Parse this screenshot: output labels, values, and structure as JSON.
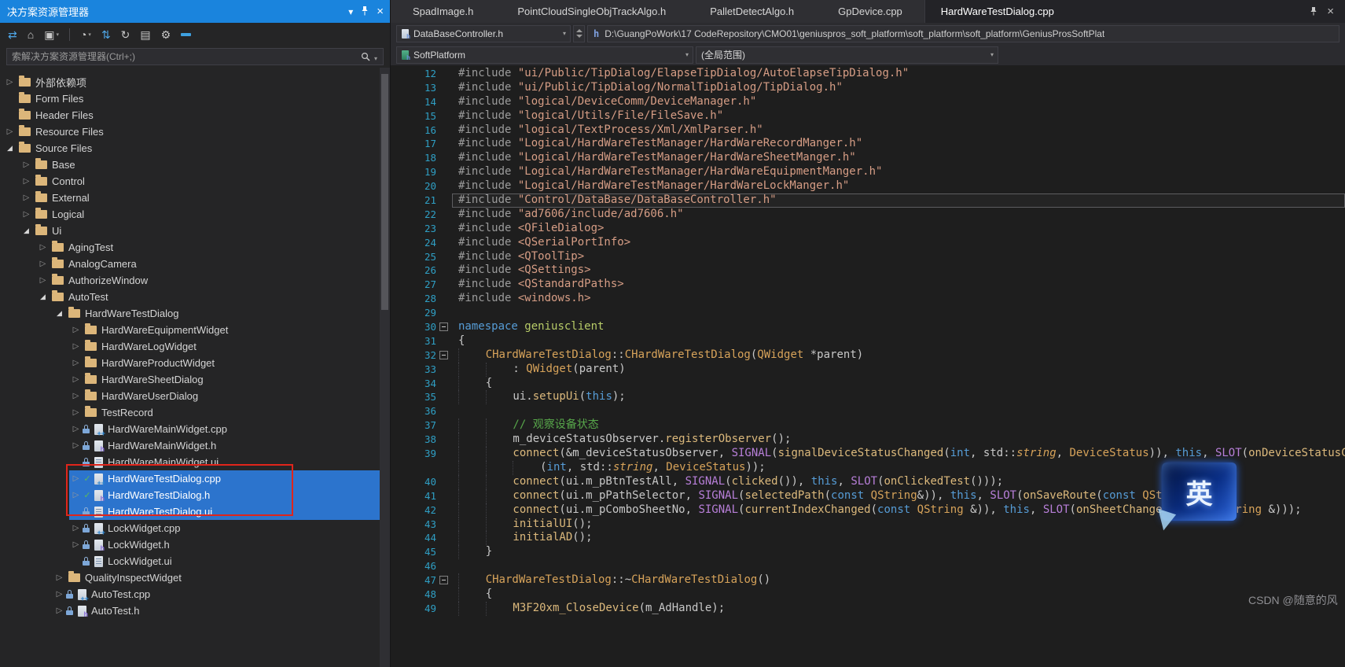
{
  "icons": {
    "chevron_down": "▾",
    "close": "×",
    "search_caret": "▾",
    "tree_collapsed": "▷",
    "tree_expanded": "◢",
    "check": "✓"
  },
  "watermark": "CSDN @随意的风",
  "ime": {
    "label": "英"
  },
  "solution_explorer": {
    "title": "决方案资源管理器",
    "search_placeholder": "索解决方案资源管理器(Ctrl+;)",
    "toolbar": [
      {
        "name": "back-forward-icon",
        "glyph": "⇄",
        "color": "#4fa7e8"
      },
      {
        "name": "home-icon",
        "glyph": "⌂",
        "color": "#c8c8c8"
      },
      {
        "name": "switch-views-icon",
        "glyph": "▣",
        "color": "#c8c8c8",
        "caret": true
      },
      {
        "name": "separator"
      },
      {
        "name": "pending-changes-filter-icon",
        "glyph": "◔",
        "color": "#c8c8c8",
        "caret": true
      },
      {
        "name": "sync-with-active-document-icon",
        "glyph": "⇅",
        "color": "#4fa7e8"
      },
      {
        "name": "refresh-icon",
        "glyph": "↻",
        "color": "#c8c8c8"
      },
      {
        "name": "collapse-all-icon",
        "glyph": "▤",
        "color": "#c8c8c8"
      },
      {
        "name": "properties-wrench-icon",
        "glyph": "⚙",
        "color": "#c8c8c8"
      },
      {
        "name": "blue-dash-icon",
        "glyph": "bar",
        "color": "#3ea0e0"
      }
    ],
    "tree": [
      {
        "label": "外部依赖项",
        "depth": 0,
        "expand": "closed",
        "icon": "folder"
      },
      {
        "label": "Form Files",
        "depth": 0,
        "expand": "none",
        "icon": "folder"
      },
      {
        "label": "Header Files",
        "depth": 0,
        "expand": "none",
        "icon": "folder"
      },
      {
        "label": "Resource Files",
        "depth": 0,
        "expand": "closed",
        "icon": "folder"
      },
      {
        "label": "Source Files",
        "depth": 0,
        "expand": "open",
        "icon": "folder"
      },
      {
        "label": "Base",
        "depth": 1,
        "expand": "closed",
        "icon": "folder"
      },
      {
        "label": "Control",
        "depth": 1,
        "expand": "closed",
        "icon": "folder"
      },
      {
        "label": "External",
        "depth": 1,
        "expand": "closed",
        "icon": "folder"
      },
      {
        "label": "Logical",
        "depth": 1,
        "expand": "closed",
        "icon": "folder"
      },
      {
        "label": "Ui",
        "depth": 1,
        "expand": "open",
        "icon": "folder"
      },
      {
        "label": "AgingTest",
        "depth": 2,
        "expand": "closed",
        "icon": "folder"
      },
      {
        "label": "AnalogCamera",
        "depth": 2,
        "expand": "closed",
        "icon": "folder"
      },
      {
        "label": "AuthorizeWindow",
        "depth": 2,
        "expand": "closed",
        "icon": "folder"
      },
      {
        "label": "AutoTest",
        "depth": 2,
        "expand": "open",
        "icon": "folder"
      },
      {
        "label": "HardWareTestDialog",
        "depth": 3,
        "expand": "open",
        "icon": "folder"
      },
      {
        "label": "HardWareEquipmentWidget",
        "depth": 4,
        "expand": "closed",
        "icon": "folder"
      },
      {
        "label": "HardWareLogWidget",
        "depth": 4,
        "expand": "closed",
        "icon": "folder"
      },
      {
        "label": "HardWareProductWidget",
        "depth": 4,
        "expand": "closed",
        "icon": "folder"
      },
      {
        "label": "HardWareSheetDialog",
        "depth": 4,
        "expand": "closed",
        "icon": "folder"
      },
      {
        "label": "HardWareUserDialog",
        "depth": 4,
        "expand": "closed",
        "icon": "folder"
      },
      {
        "label": "TestRecord",
        "depth": 4,
        "expand": "closed",
        "icon": "folder"
      },
      {
        "label": "HardWareMainWidget.cpp",
        "depth": 4,
        "expand": "closed",
        "icon": "cpp",
        "badge": "lock"
      },
      {
        "label": "HardWareMainWidget.h",
        "depth": 4,
        "expand": "closed",
        "icon": "h",
        "badge": "lock"
      },
      {
        "label": "HardWareMainWidget.ui",
        "depth": 4,
        "expand": "none",
        "icon": "ui",
        "badge": "lock"
      },
      {
        "label": "HardWareTestDialog.cpp",
        "depth": 4,
        "expand": "closed",
        "icon": "cpp",
        "badge": "check",
        "selected": true
      },
      {
        "label": "HardWareTestDialog.h",
        "depth": 4,
        "expand": "closed",
        "icon": "h",
        "badge": "check",
        "selected": true
      },
      {
        "label": "HardWareTestDialog.ui",
        "depth": 4,
        "expand": "none",
        "icon": "ui",
        "badge": "lock",
        "selected": true
      },
      {
        "label": "LockWidget.cpp",
        "depth": 4,
        "expand": "closed",
        "icon": "cpp",
        "badge": "lock"
      },
      {
        "label": "LockWidget.h",
        "depth": 4,
        "expand": "closed",
        "icon": "h",
        "badge": "lock"
      },
      {
        "label": "LockWidget.ui",
        "depth": 4,
        "expand": "none",
        "icon": "ui",
        "badge": "lock"
      },
      {
        "label": "QualityInspectWidget",
        "depth": 3,
        "expand": "closed",
        "icon": "folder"
      },
      {
        "label": "AutoTest.cpp",
        "depth": 3,
        "expand": "closed",
        "icon": "cpp",
        "badge": "lock"
      },
      {
        "label": "AutoTest.h",
        "depth": 3,
        "expand": "closed",
        "icon": "h",
        "badge": "lock"
      }
    ]
  },
  "editor": {
    "tabs": [
      {
        "label": "SpadImage.h"
      },
      {
        "label": "PointCloudSingleObjTrackAlgo.h"
      },
      {
        "label": "PalletDetectAlgo.h"
      },
      {
        "label": "GpDevice.cpp"
      },
      {
        "label": "HardWareTestDialog.cpp",
        "active": true
      }
    ],
    "nav": {
      "dropdown": "DataBaseController.h",
      "path": "D:\\GuangPoWork\\17 CodeRepository\\CMO01\\geniuspros_soft_platform\\soft_platform\\soft_platform\\GeniusProsSoftPlat",
      "project": "SoftPlatform",
      "scope": "(全局范围)"
    },
    "code_lines": [
      {
        "n": "12",
        "s": [
          [
            "pp",
            "#include "
          ],
          [
            "str",
            "\"ui/Public/TipDialog/ElapseTipDialog/AutoElapseTipDialog.h\""
          ]
        ]
      },
      {
        "n": "13",
        "s": [
          [
            "pp",
            "#include "
          ],
          [
            "str",
            "\"ui/Public/TipDialog/NormalTipDialog/TipDialog.h\""
          ]
        ]
      },
      {
        "n": "14",
        "s": [
          [
            "pp",
            "#include "
          ],
          [
            "str",
            "\"logical/DeviceComm/DeviceManager.h\""
          ]
        ]
      },
      {
        "n": "15",
        "s": [
          [
            "pp",
            "#include "
          ],
          [
            "str",
            "\"logical/Utils/File/FileSave.h\""
          ]
        ]
      },
      {
        "n": "16",
        "s": [
          [
            "pp",
            "#include "
          ],
          [
            "str",
            "\"logical/TextProcess/Xml/XmlParser.h\""
          ]
        ]
      },
      {
        "n": "17",
        "s": [
          [
            "pp",
            "#include "
          ],
          [
            "str",
            "\"Logical/HardWareTestManager/HardWareRecordManger.h\""
          ]
        ]
      },
      {
        "n": "18",
        "s": [
          [
            "pp",
            "#include "
          ],
          [
            "str",
            "\"Logical/HardWareTestManager/HardWareSheetManger.h\""
          ]
        ]
      },
      {
        "n": "19",
        "s": [
          [
            "pp",
            "#include "
          ],
          [
            "str",
            "\"Logical/HardWareTestManager/HardWareEquipmentManger.h\""
          ]
        ]
      },
      {
        "n": "20",
        "s": [
          [
            "pp",
            "#include "
          ],
          [
            "str",
            "\"Logical/HardWareTestManager/HardWareLockManger.h\""
          ]
        ]
      },
      {
        "n": "21",
        "cur": true,
        "s": [
          [
            "pp",
            "#include "
          ],
          [
            "str",
            "\"Control/DataBase/DataBaseController.h\""
          ]
        ]
      },
      {
        "n": "22",
        "s": [
          [
            "pp",
            "#include "
          ],
          [
            "str",
            "\"ad7606/include/ad7606.h\""
          ]
        ]
      },
      {
        "n": "23",
        "s": [
          [
            "pp",
            "#include "
          ],
          [
            "str",
            "<QFileDialog>"
          ]
        ]
      },
      {
        "n": "24",
        "s": [
          [
            "pp",
            "#include "
          ],
          [
            "str",
            "<QSerialPortInfo>"
          ]
        ]
      },
      {
        "n": "25",
        "s": [
          [
            "pp",
            "#include "
          ],
          [
            "str",
            "<QToolTip>"
          ]
        ]
      },
      {
        "n": "26",
        "s": [
          [
            "pp",
            "#include "
          ],
          [
            "str",
            "<QSettings>"
          ]
        ]
      },
      {
        "n": "27",
        "s": [
          [
            "pp",
            "#include "
          ],
          [
            "str",
            "<QStandardPaths>"
          ]
        ]
      },
      {
        "n": "28",
        "s": [
          [
            "pp",
            "#include "
          ],
          [
            "str",
            "<windows.h>"
          ]
        ]
      },
      {
        "n": "29",
        "s": []
      },
      {
        "n": "30",
        "fold": true,
        "s": [
          [
            "kw",
            "namespace"
          ],
          [
            "id",
            " "
          ],
          [
            "ns",
            "geniusclient"
          ]
        ]
      },
      {
        "n": "31",
        "s": [
          [
            "id",
            "{"
          ]
        ]
      },
      {
        "n": "32",
        "fold": true,
        "s": [
          [
            "id",
            "    "
          ],
          [
            "type",
            "CHardWareTestDialog"
          ],
          [
            "id",
            "::"
          ],
          [
            "type",
            "CHardWareTestDialog"
          ],
          [
            "id",
            "("
          ],
          [
            "type",
            "QWidget"
          ],
          [
            "id",
            " *parent)"
          ]
        ]
      },
      {
        "n": "33",
        "s": [
          [
            "id",
            "        : "
          ],
          [
            "type",
            "QWidget"
          ],
          [
            "id",
            "(parent)"
          ]
        ]
      },
      {
        "n": "34",
        "s": [
          [
            "id",
            "    {"
          ]
        ]
      },
      {
        "n": "35",
        "s": [
          [
            "id",
            "        ui."
          ],
          [
            "fn",
            "setupUi"
          ],
          [
            "id",
            "("
          ],
          [
            "kw",
            "this"
          ],
          [
            "id",
            ");"
          ]
        ]
      },
      {
        "n": "36",
        "s": []
      },
      {
        "n": "37",
        "s": [
          [
            "id",
            "        "
          ],
          [
            "cmt",
            "// 观察设备状态"
          ]
        ]
      },
      {
        "n": "38",
        "s": [
          [
            "id",
            "        m_deviceStatusObserver."
          ],
          [
            "fn",
            "registerObserver"
          ],
          [
            "id",
            "();"
          ]
        ]
      },
      {
        "n": "39",
        "s": [
          [
            "id",
            "        "
          ],
          [
            "fn",
            "connect"
          ],
          [
            "id",
            "(&m_deviceStatusObserver, "
          ],
          [
            "mac",
            "SIGNAL"
          ],
          [
            "id",
            "("
          ],
          [
            "fn",
            "signalDeviceStatusChanged"
          ],
          [
            "id",
            "("
          ],
          [
            "kw",
            "int"
          ],
          [
            "id",
            ", std::"
          ],
          [
            "typei",
            "string"
          ],
          [
            "id",
            ", "
          ],
          [
            "type",
            "DeviceStatus"
          ],
          [
            "id",
            ")), "
          ],
          [
            "kw",
            "this"
          ],
          [
            "id",
            ", "
          ],
          [
            "mac",
            "SLOT"
          ],
          [
            "id",
            "("
          ],
          [
            "fn",
            "onDeviceStatusChanged"
          ],
          [
            "id",
            "("
          ]
        ]
      },
      {
        "n": "",
        "s": [
          [
            "id",
            "            ("
          ],
          [
            "kw",
            "int"
          ],
          [
            "id",
            ", std::"
          ],
          [
            "typei",
            "string"
          ],
          [
            "id",
            ", "
          ],
          [
            "type",
            "DeviceStatus"
          ],
          [
            "id",
            "));"
          ]
        ]
      },
      {
        "n": "40",
        "s": [
          [
            "id",
            "        "
          ],
          [
            "fn",
            "connect"
          ],
          [
            "id",
            "(ui.m_pBtnTestAll, "
          ],
          [
            "mac",
            "SIGNAL"
          ],
          [
            "id",
            "("
          ],
          [
            "fn",
            "clicked"
          ],
          [
            "id",
            "()), "
          ],
          [
            "kw",
            "this"
          ],
          [
            "id",
            ", "
          ],
          [
            "mac",
            "SLOT"
          ],
          [
            "id",
            "("
          ],
          [
            "fn",
            "onClickedTest"
          ],
          [
            "id",
            "()));"
          ]
        ]
      },
      {
        "n": "41",
        "s": [
          [
            "id",
            "        "
          ],
          [
            "fn",
            "connect"
          ],
          [
            "id",
            "(ui.m_pPathSelector, "
          ],
          [
            "mac",
            "SIGNAL"
          ],
          [
            "id",
            "("
          ],
          [
            "fn",
            "selectedPath"
          ],
          [
            "id",
            "("
          ],
          [
            "kw",
            "const"
          ],
          [
            "id",
            " "
          ],
          [
            "type",
            "QString"
          ],
          [
            "id",
            "&)), "
          ],
          [
            "kw",
            "this"
          ],
          [
            "id",
            ", "
          ],
          [
            "mac",
            "SLOT"
          ],
          [
            "id",
            "("
          ],
          [
            "fn",
            "onSaveRoute"
          ],
          [
            "id",
            "("
          ],
          [
            "kw",
            "const"
          ],
          [
            "id",
            " "
          ],
          [
            "type",
            "QString"
          ],
          [
            "id",
            "&)));"
          ]
        ]
      },
      {
        "n": "42",
        "s": [
          [
            "id",
            "        "
          ],
          [
            "fn",
            "connect"
          ],
          [
            "id",
            "(ui.m_pComboSheetNo, "
          ],
          [
            "mac",
            "SIGNAL"
          ],
          [
            "id",
            "("
          ],
          [
            "fn",
            "currentIndexChanged"
          ],
          [
            "id",
            "("
          ],
          [
            "kw",
            "const"
          ],
          [
            "id",
            " "
          ],
          [
            "type",
            "QString"
          ],
          [
            "id",
            " &)), "
          ],
          [
            "kw",
            "this"
          ],
          [
            "id",
            ", "
          ],
          [
            "mac",
            "SLOT"
          ],
          [
            "id",
            "("
          ],
          [
            "fn",
            "onSheetChanged"
          ],
          [
            "id",
            "("
          ],
          [
            "kw",
            "const"
          ],
          [
            "id",
            " "
          ],
          [
            "type",
            "QString"
          ],
          [
            "id",
            " &)));"
          ]
        ]
      },
      {
        "n": "43",
        "s": [
          [
            "id",
            "        "
          ],
          [
            "fn",
            "initialUI"
          ],
          [
            "id",
            "();"
          ]
        ]
      },
      {
        "n": "44",
        "s": [
          [
            "id",
            "        "
          ],
          [
            "fn",
            "initialAD"
          ],
          [
            "id",
            "();"
          ]
        ]
      },
      {
        "n": "45",
        "s": [
          [
            "id",
            "    }"
          ]
        ]
      },
      {
        "n": "46",
        "s": []
      },
      {
        "n": "47",
        "fold": true,
        "s": [
          [
            "id",
            "    "
          ],
          [
            "type",
            "CHardWareTestDialog"
          ],
          [
            "id",
            "::~"
          ],
          [
            "type",
            "CHardWareTestDialog"
          ],
          [
            "id",
            "()"
          ]
        ]
      },
      {
        "n": "48",
        "s": [
          [
            "id",
            "    {"
          ]
        ]
      },
      {
        "n": "49",
        "s": [
          [
            "id",
            "        "
          ],
          [
            "fn",
            "M3F20xm_CloseDevice"
          ],
          [
            "id",
            "(m_AdHandle);"
          ]
        ]
      }
    ]
  }
}
